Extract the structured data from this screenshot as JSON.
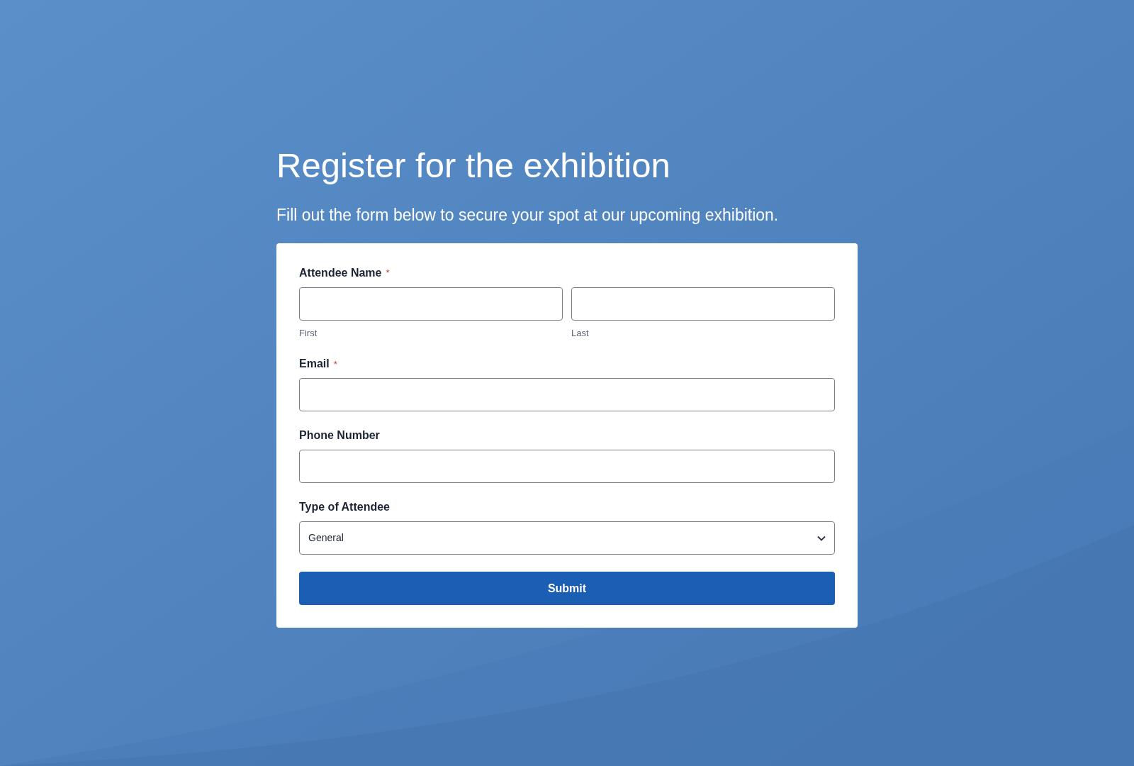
{
  "heading": "Register for the exhibition",
  "subtitle": "Fill out the form below to secure your spot at our upcoming exhibition.",
  "required_mark": "*",
  "fields": [
    {
      "kind": "name",
      "label": "Attendee Name",
      "required": true,
      "parts": [
        {
          "sublabel": "First"
        },
        {
          "sublabel": "Last"
        }
      ]
    },
    {
      "kind": "text",
      "label": "Email",
      "required": true
    },
    {
      "kind": "text",
      "label": "Phone Number",
      "required": false
    },
    {
      "kind": "select",
      "label": "Type of Attendee",
      "required": false,
      "value": "General"
    }
  ],
  "submit": "Submit"
}
